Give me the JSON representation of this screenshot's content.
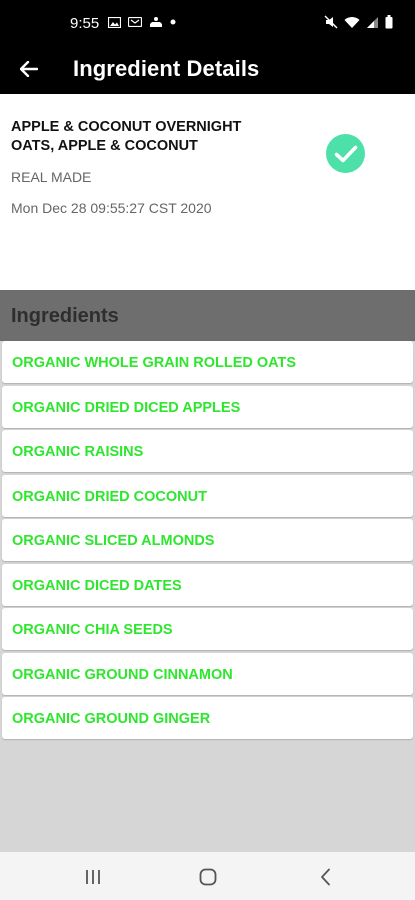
{
  "status_bar": {
    "time": "9:55",
    "left_icons": [
      "gallery-icon",
      "link-icon",
      "cast-icon",
      "dot-icon"
    ],
    "right_icons": [
      "mute-icon",
      "wifi-icon",
      "signal-icon",
      "battery-icon"
    ]
  },
  "app_bar": {
    "back_icon": "arrow-left-icon",
    "title": "Ingredient Details"
  },
  "product": {
    "name": "APPLE & COCONUT OVERNIGHT OATS, APPLE & COCONUT",
    "brand": "REAL MADE",
    "date": "Mon Dec 28 09:55:27 CST 2020",
    "status_icon": "check-circle-icon",
    "status_color": "#4de0a8"
  },
  "ingredients": {
    "title": "Ingredients",
    "item_color": "#2ee62e",
    "items": [
      "ORGANIC WHOLE GRAIN ROLLED OATS",
      "ORGANIC DRIED DICED APPLES",
      "ORGANIC RAISINS",
      "ORGANIC DRIED COCONUT",
      "ORGANIC SLICED ALMONDS",
      "ORGANIC DICED DATES",
      "ORGANIC CHIA SEEDS",
      "ORGANIC GROUND CINNAMON",
      "ORGANIC GROUND GINGER"
    ]
  },
  "nav_bar": {
    "buttons": [
      "recent-apps-icon",
      "home-icon",
      "back-icon"
    ]
  }
}
